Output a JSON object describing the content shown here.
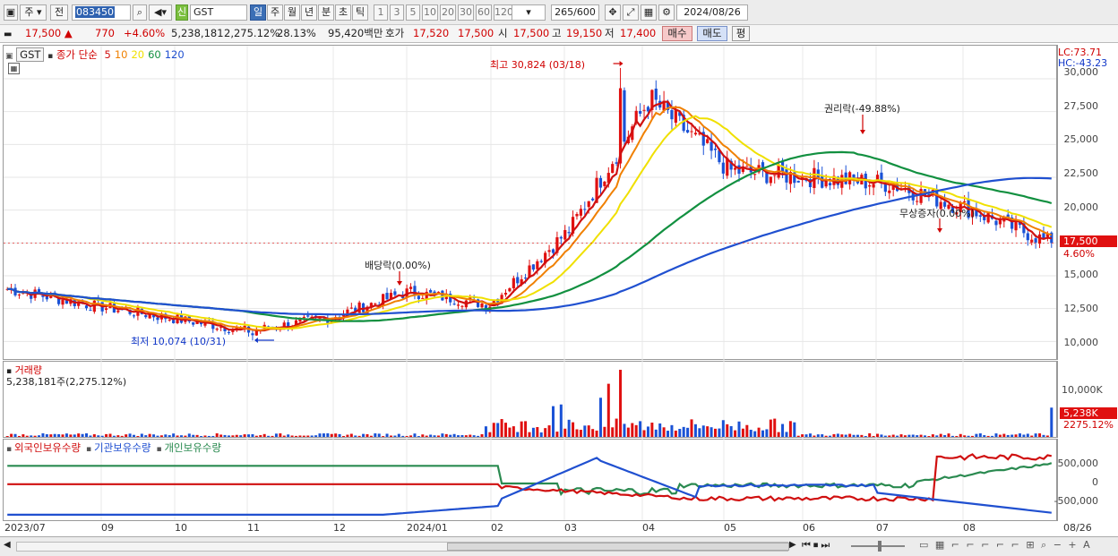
{
  "toolbar": {
    "period_select": "주",
    "prev_label": "전",
    "stock_code": "083450",
    "stock_name": "GST",
    "stock_badge": "신",
    "timeframes": [
      "일",
      "주",
      "월",
      "년",
      "분",
      "초",
      "틱"
    ],
    "selected_timeframe": "일",
    "intervals": [
      "1",
      "3",
      "5",
      "10",
      "20",
      "30",
      "60",
      "120"
    ],
    "count_display": "265",
    "count_max": "/600",
    "date": "2024/08/26"
  },
  "infobar": {
    "price": "17,500 ▲",
    "change": "770",
    "change_pct": "+4.60%",
    "volume": "5,238,181",
    "volume_pct": "2,275.12%",
    "turnover_pct": "28.13%",
    "amount": "95,420백만",
    "quote_label": "호가",
    "bid": "17,520",
    "ask": "17,500",
    "open_label": "시",
    "open": "17,500",
    "high_label": "고",
    "high": "19,150",
    "low_label": "저",
    "low": "17,400",
    "buy_btn": "매수",
    "sell_btn": "매도",
    "eval_btn": "평"
  },
  "price_panel": {
    "symbol": "GST",
    "ma_title": "종가 단순",
    "ma_periods": [
      "5",
      "10",
      "20",
      "60",
      "120"
    ],
    "ma_colors": [
      "#d01010",
      "#f08000",
      "#f0e000",
      "#129040",
      "#2050d0"
    ],
    "lc": "LC:73.71",
    "hc": "HC:-43.23",
    "price_tag": "17,500",
    "pct_tag": "4.60%",
    "y_ticks": [
      "30,000",
      "27,500",
      "25,000",
      "22,500",
      "20,000",
      "17,500",
      "15,000",
      "12,500",
      "10,000"
    ],
    "annotations": {
      "high": "최고 30,824 (03/18)",
      "low": "최저 10,074 (10/31)",
      "dividend": "배당락(0.00%)",
      "rights": "권리락(-49.88%)",
      "bonus": "무상증자(0.00%)"
    }
  },
  "volume_panel": {
    "title": "거래량",
    "value": "5,238,181주(2,275.12%)",
    "y_tick": "10,000K",
    "tag_value": "5,238K",
    "tag_pct": "2275.12%"
  },
  "holdings_panel": {
    "legend": [
      "외국인보유수량",
      "기관보유수량",
      "개인보유수량"
    ],
    "legend_colors": [
      "#d01010",
      "#2050d0",
      "#2a8a50"
    ],
    "y_ticks": [
      "500,000",
      "0",
      "-500,000"
    ]
  },
  "x_axis": {
    "labels": [
      "2023/07",
      "09",
      "10",
      "11",
      "12",
      "2024/01",
      "02",
      "03",
      "04",
      "05",
      "06",
      "07",
      "08",
      "08/26"
    ]
  },
  "chart_data": {
    "type": "candlestick",
    "symbol": "GST",
    "ylim": [
      9000,
      31500
    ],
    "monthly_closes": [
      {
        "month": "2023/07",
        "close": 14000
      },
      {
        "month": "2023/08",
        "close": 12800
      },
      {
        "month": "2023/09",
        "close": 11800
      },
      {
        "month": "2023/10",
        "close": 10800
      },
      {
        "month": "2023/11",
        "close": 11800
      },
      {
        "month": "2023/12",
        "close": 13800
      },
      {
        "month": "2024/01",
        "close": 12800
      },
      {
        "month": "2024/02",
        "close": 18500
      },
      {
        "month": "2024/03",
        "close": 28500
      },
      {
        "month": "2024/04",
        "close": 23000
      },
      {
        "month": "2024/05",
        "close": 22500
      },
      {
        "month": "2024/06",
        "close": 22000
      },
      {
        "month": "2024/07",
        "close": 20000
      },
      {
        "month": "2024/08",
        "close": 17500
      }
    ],
    "high": {
      "value": 30824,
      "date": "03/18"
    },
    "low": {
      "value": 10074,
      "date": "10/31"
    },
    "last": 17500
  }
}
